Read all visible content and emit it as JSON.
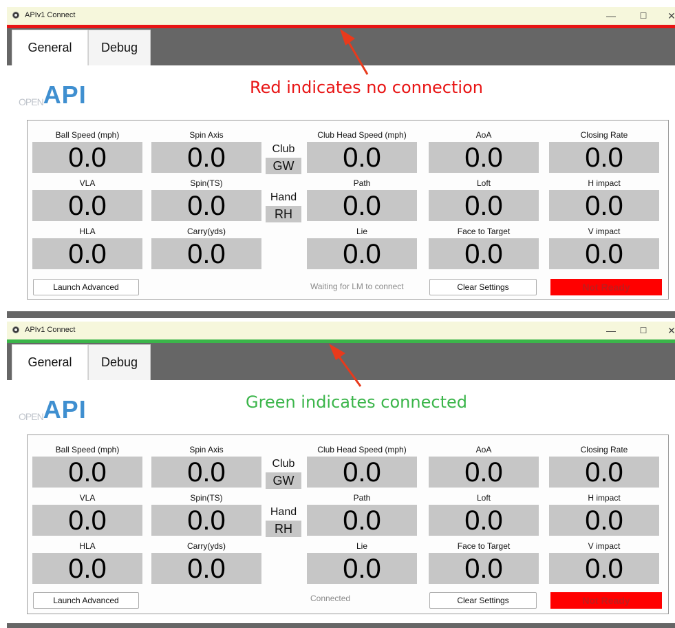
{
  "window": {
    "title": "APIv1 Connect",
    "minimize_label": "—",
    "maximize_label": "☐",
    "close_label": "✕"
  },
  "tabs": {
    "general": "General",
    "debug": "Debug"
  },
  "logo": {
    "open": "OPEN",
    "api": "API"
  },
  "colors": {
    "disconnected": "#e81414",
    "connected": "#3bb54a",
    "badge": "#ff0000"
  },
  "labels": {
    "ball_speed": "Ball Speed (mph)",
    "spin_axis": "Spin Axis",
    "club_head_speed": "Club Head Speed (mph)",
    "aoa": "AoA",
    "closing_rate": "Closing Rate",
    "vla": "VLA",
    "spin_ts": "Spin(TS)",
    "path": "Path",
    "loft": "Loft",
    "h_impact": "H impact",
    "hla": "HLA",
    "carry": "Carry(yds)",
    "lie": "Lie",
    "face_to_target": "Face to Target",
    "v_impact": "V impact",
    "club": "Club",
    "hand": "Hand"
  },
  "buttons": {
    "launch_advanced": "Launch Advanced",
    "clear_settings": "Clear Settings"
  },
  "panels": [
    {
      "annotation": "Red indicates no connection",
      "status_text": "Waiting for LM to connect",
      "ready": "Not Ready",
      "club": "GW",
      "hand": "RH",
      "values": {
        "ball_speed": "0.0",
        "spin_axis": "0.0",
        "club_head_speed": "0.0",
        "aoa": "0.0",
        "closing_rate": "0.0",
        "vla": "0.0",
        "spin_ts": "0.0",
        "path": "0.0",
        "loft": "0.0",
        "h_impact": "0.0",
        "hla": "0.0",
        "carry": "0.0",
        "lie": "0.0",
        "face_to_target": "0.0",
        "v_impact": "0.0"
      }
    },
    {
      "annotation": "Green indicates connected",
      "status_text": "Connected",
      "ready": "Not Ready",
      "club": "GW",
      "hand": "RH",
      "values": {
        "ball_speed": "0.0",
        "spin_axis": "0.0",
        "club_head_speed": "0.0",
        "aoa": "0.0",
        "closing_rate": "0.0",
        "vla": "0.0",
        "spin_ts": "0.0",
        "path": "0.0",
        "loft": "0.0",
        "h_impact": "0.0",
        "hla": "0.0",
        "carry": "0.0",
        "lie": "0.0",
        "face_to_target": "0.0",
        "v_impact": "0.0"
      }
    }
  ]
}
